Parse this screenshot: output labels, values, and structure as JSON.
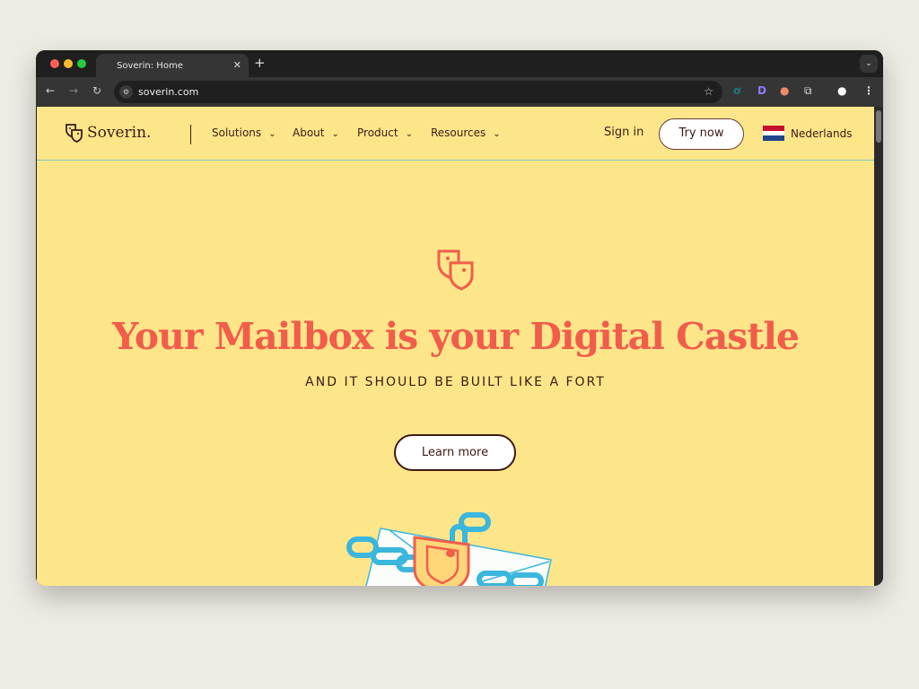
{
  "browser": {
    "tab_title": "Soverin: Home",
    "url": "soverin.com"
  },
  "nav": {
    "brand": "Soverin.",
    "items": [
      {
        "label": "Solutions"
      },
      {
        "label": "About"
      },
      {
        "label": "Product"
      },
      {
        "label": "Resources"
      }
    ],
    "sign_in": "Sign in",
    "try_now": "Try now",
    "language": "Nederlands"
  },
  "hero": {
    "title": "Your Mailbox is your Digital Castle",
    "subtitle": "AND IT SHOULD BE BUILT LIKE A FORT",
    "cta": "Learn more"
  },
  "colors": {
    "background": "#fde68a",
    "accent": "#f25c4a",
    "text": "#3d1a14",
    "chain": "#3bb6dd"
  }
}
